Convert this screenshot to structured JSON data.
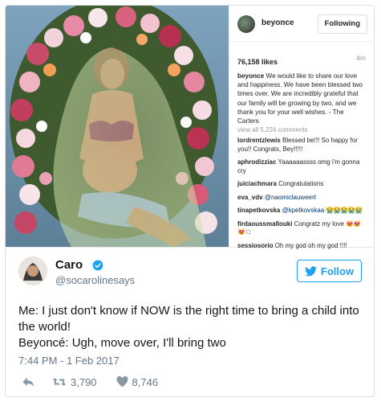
{
  "instagram": {
    "username": "beyonce",
    "follow_label": "Following",
    "likes": "76,158 likes",
    "time": "4m",
    "caption_user": "beyonce",
    "caption_text": "We would like to share our love and happiness. We have been blessed two times over. We are incredibly grateful that our family will be growing by two, and we thank you for your well wishes. - The Carters",
    "view_all": "view all 5,224 comments",
    "comments": [
      {
        "user": "lordrentzlewis",
        "text": "Blessed be!!! So happy for you!! Congrats, Bey!!!!!"
      },
      {
        "user": "aphrodizziac",
        "text": "Yaaaaaassss omg i'm gonna cry"
      },
      {
        "user": "juiciachmara",
        "text": "Congratulations"
      },
      {
        "user": "eva_vdv",
        "mention": "@naomiclauweert",
        "text": ""
      },
      {
        "user": "tinapetkovska",
        "mention": "@kpetkovskaa",
        "emoji": "😭😭😭😭😭"
      },
      {
        "user": "firdaoussmallouki",
        "text": "Congratz my love",
        "emoji": "😻😻😻",
        "extra": "□"
      },
      {
        "user": "sessiosorio",
        "text": "Oh my god oh my god !!!!"
      }
    ]
  },
  "tweet": {
    "name": "Caro",
    "handle": "@socarolinesays",
    "follow_label": "Follow",
    "text_line1": "Me: I just don't know if NOW is the right time to bring a child into the world!",
    "text_line2": "Beyoncé: Ugh, move over, I'll bring two",
    "timestamp": "7:44 PM - 1 Feb 2017",
    "retweets": "3,790",
    "likes": "8,746"
  },
  "colors": {
    "twitter_blue": "#1da1f2",
    "secondary_text": "#657786"
  }
}
